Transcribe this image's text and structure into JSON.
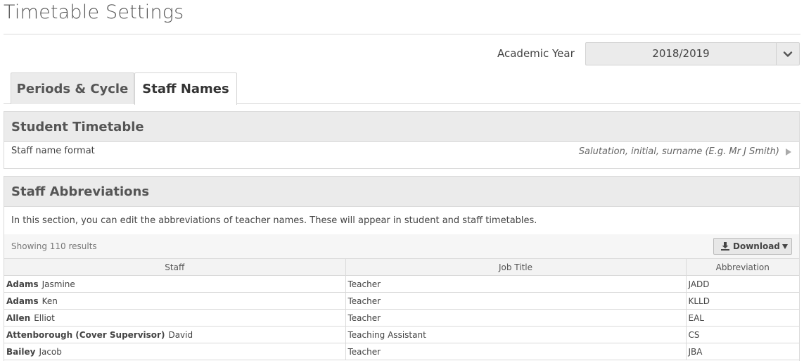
{
  "page": {
    "title": "Timetable Settings"
  },
  "academic_year": {
    "label": "Academic Year",
    "value": "2018/2019"
  },
  "tabs": [
    {
      "label": "Periods & Cycle",
      "active": false
    },
    {
      "label": "Staff Names",
      "active": true
    }
  ],
  "student_timetable": {
    "title": "Student Timetable",
    "format_label": "Staff name format",
    "format_value": "Salutation, initial, surname (E.g. Mr J Smith)"
  },
  "staff_abbreviations": {
    "title": "Staff Abbreviations",
    "intro": "In this section, you can edit the abbreviations of teacher names. These will appear in student and staff timetables.",
    "results": "Showing 110 results",
    "download_label": "Download",
    "columns": [
      "Staff",
      "Job Title",
      "Abbreviation"
    ],
    "rows": [
      {
        "surname": "Adams",
        "forename": "Jasmine",
        "job": "Teacher",
        "abbr": "JADD"
      },
      {
        "surname": "Adams",
        "forename": "Ken",
        "job": "Teacher",
        "abbr": "KLLD"
      },
      {
        "surname": "Allen",
        "forename": "Elliot",
        "job": "Teacher",
        "abbr": "EAL"
      },
      {
        "surname": "Attenborough (Cover Supervisor)",
        "forename": "David",
        "job": "Teaching Assistant",
        "abbr": "CS"
      },
      {
        "surname": "Bailey",
        "forename": "Jacob",
        "job": "Teacher",
        "abbr": "JBA"
      }
    ]
  },
  "colors": {
    "panel_header": "#ebebeb",
    "border": "#dadada",
    "text": "#444444"
  },
  "icons": {
    "year_select": "chevron-down-icon",
    "format": "caret-right-icon",
    "download": "download-icon"
  }
}
